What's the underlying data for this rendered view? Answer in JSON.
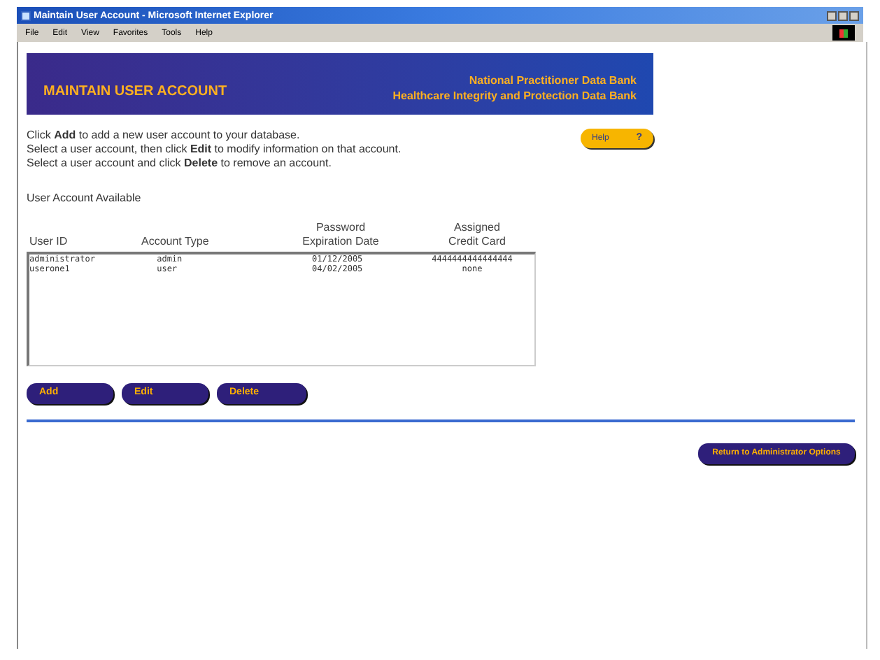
{
  "window": {
    "title": "Maintain User Account - Microsoft Internet Explorer"
  },
  "menu": [
    "File",
    "Edit",
    "View",
    "Favorites",
    "Tools",
    "Help"
  ],
  "banner": {
    "title": "MAINTAIN USER ACCOUNT",
    "org_lines": [
      "National Practitioner Data Bank",
      "Healthcare Integrity and Protection Data Bank"
    ]
  },
  "instructions": [
    "Click **Add** to add a new user account to your database.",
    "Select a user account, then click **Edit** to modify information on that account.",
    "Select a user account and click **Delete** to remove an account."
  ],
  "help_button": {
    "label": "Help",
    "icon": "?"
  },
  "list_title": "User Account Available",
  "table": {
    "columns": [
      "User ID",
      "Account Type",
      "Password Expiration Date",
      "Assigned Credit Card"
    ],
    "rows": [
      {
        "cells": [
          "administrator",
          "admin",
          "01/12/2005",
          "4444444444444444"
        ],
        "selected": false
      },
      {
        "cells": [
          "userone1",
          "user",
          "04/02/2005",
          "none"
        ],
        "selected": false
      }
    ]
  },
  "actions": [
    "Add",
    "Edit",
    "Delete"
  ],
  "return_button": "Return to Administrator Options"
}
